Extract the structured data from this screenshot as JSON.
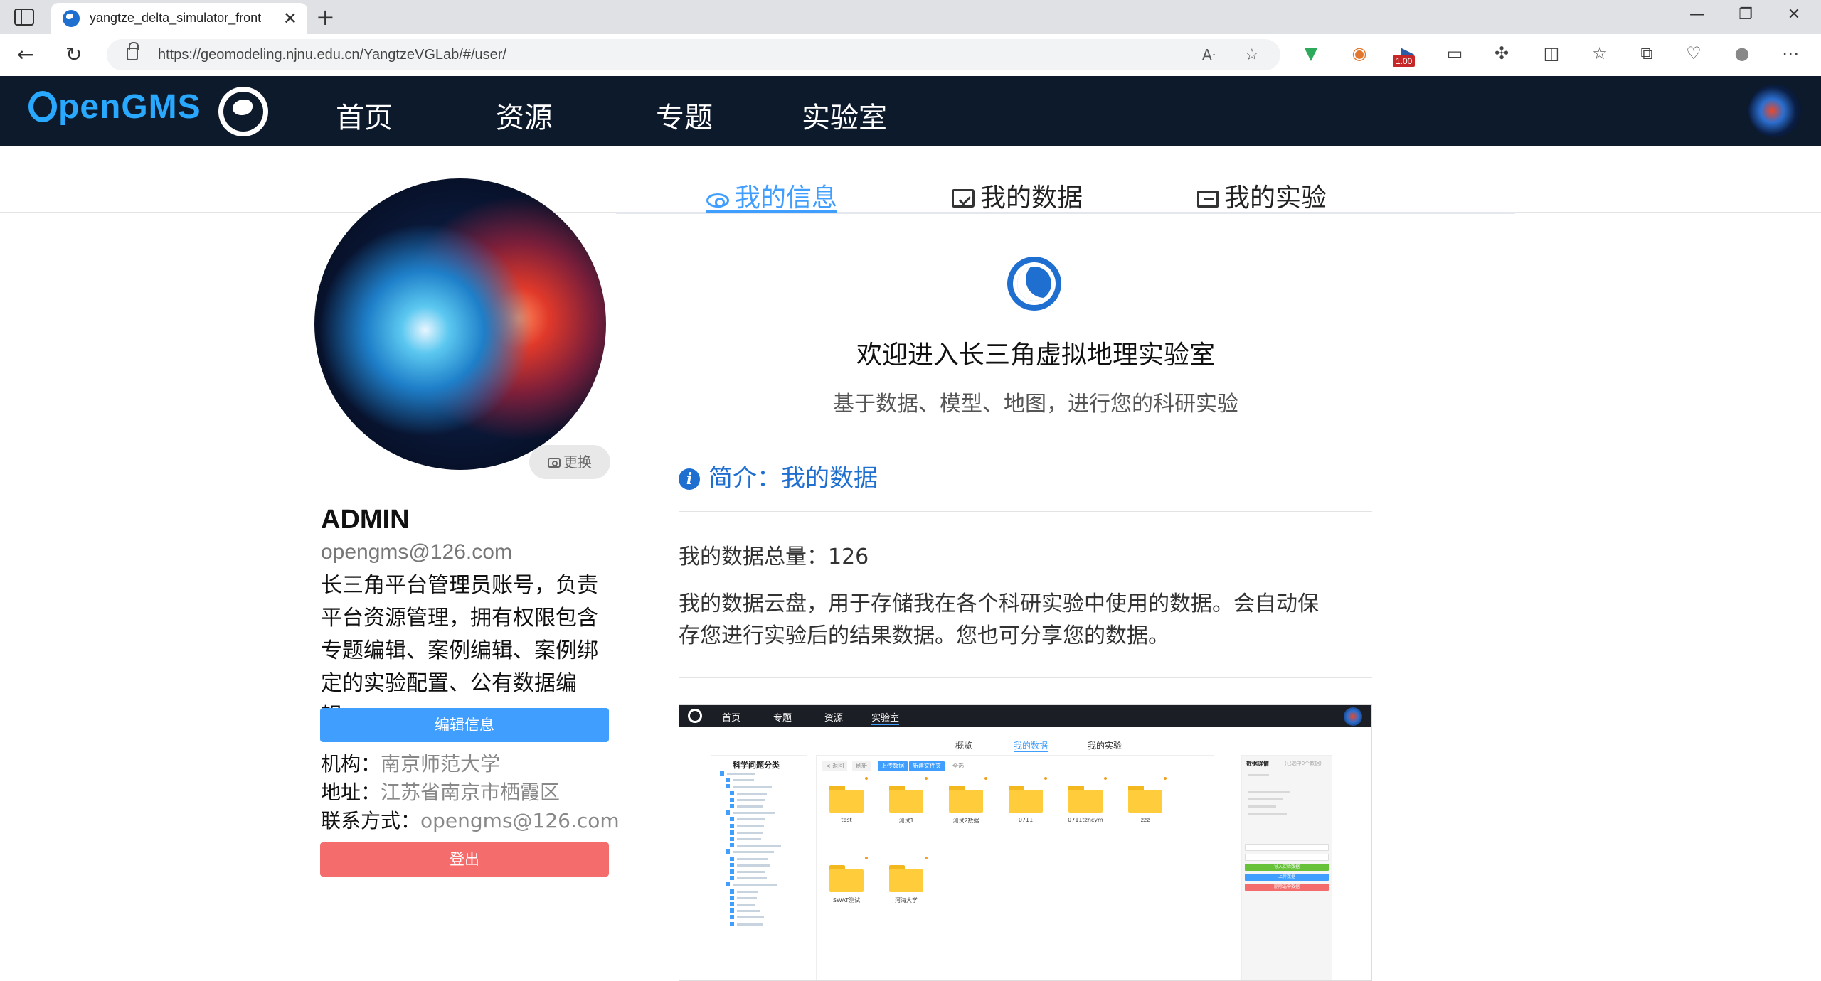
{
  "browser": {
    "tab_title": "yangtze_delta_simulator_front",
    "url": "https://geomodeling.njnu.edu.cn/YangtzeVGLab/#/user/",
    "extension_badge": "1.00"
  },
  "site": {
    "logo_text": "penGMS",
    "nav": [
      "首页",
      "资源",
      "专题",
      "实验室"
    ],
    "active_nav": "实验室"
  },
  "profile": {
    "change_avatar_label": "更换",
    "name": "ADMIN",
    "email": "opengms@126.com",
    "bio": "长三角平台管理员账号，负责平台资源管理，拥有权限包含专题编辑、案例编辑、案例绑定的实验配置、公有数据编辑。",
    "edit_button": "编辑信息",
    "org_label": "机构：",
    "org_value": "南京师范大学",
    "address_label": "地址：",
    "address_value": "江苏省南京市栖霞区",
    "contact_label": "联系方式：",
    "contact_value": "opengms@126.com",
    "logout_button": "登出"
  },
  "tabs": [
    {
      "label": "我的信息",
      "icon": "eye-icon",
      "active": true
    },
    {
      "label": "我的数据",
      "icon": "folder-icon",
      "active": false
    },
    {
      "label": "我的实验",
      "icon": "board-icon",
      "active": false
    }
  ],
  "content": {
    "welcome_title": "欢迎进入长三角虚拟地理实验室",
    "welcome_subtitle": "基于数据、模型、地图，进行您的科研实验",
    "section_title": "简介：我的数据",
    "stat_label": "我的数据总量：",
    "stat_value": "126",
    "description": "我的数据云盘，用于存储我在各个科研实验中使用的数据。会自动保存您进行实验后的结果数据。您也可分享您的数据。"
  },
  "preview": {
    "nav": [
      "首页",
      "专题",
      "资源",
      "实验室"
    ],
    "tabs": [
      "概览",
      "我的数据",
      "我的实验"
    ],
    "sidebar_title": "科学问题分类",
    "buttons": [
      "< 返回",
      "刷新",
      "上传数据",
      "新建文件夹",
      "全选"
    ],
    "folders": [
      "test",
      "测试1",
      "测试2数据",
      "0711",
      "0711tzhcym",
      "zzz",
      "SWAT测试",
      "河海大学"
    ],
    "detail_title": "数据详情",
    "detail_subtitle": "(已选中0个数据)",
    "detail_buttons": [
      "导入实验数据",
      "上传数据",
      "删除选中数据"
    ],
    "colors": {
      "green": "#67c23a",
      "blue": "#409eff",
      "red": "#f56c6c"
    }
  }
}
